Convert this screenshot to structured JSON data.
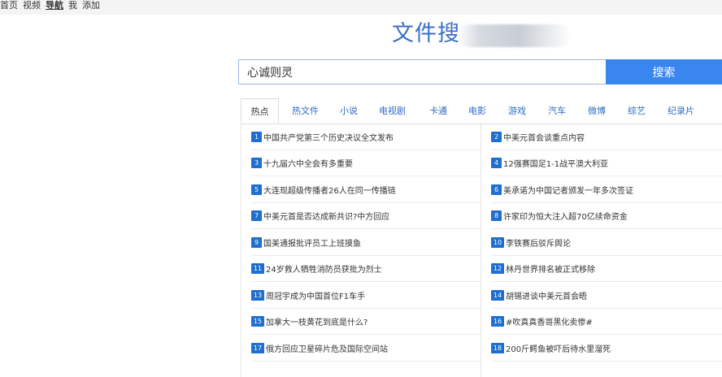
{
  "topnav": {
    "items": [
      "首页",
      "视频",
      "导航",
      "我",
      "添加"
    ],
    "active_index": 2
  },
  "site": {
    "title": "文件搜"
  },
  "search": {
    "value": "心诚则灵",
    "button_label": "搜索"
  },
  "tabs": [
    "热点",
    "热文件",
    "小说",
    "电视剧",
    "卡通",
    "电影",
    "游戏",
    "汽车",
    "微博",
    "综艺",
    "纪录片"
  ],
  "active_tab_index": 0,
  "hot_list": [
    {
      "rank": "1",
      "text": "中国共产党第三个历史决议全文发布"
    },
    {
      "rank": "2",
      "text": "中美元首会谈重点内容"
    },
    {
      "rank": "3",
      "text": "十九届六中全会有多重要"
    },
    {
      "rank": "4",
      "text": "12强赛国足1-1战平澳大利亚"
    },
    {
      "rank": "5",
      "text": "大连现超级传播者26人在同一传播链"
    },
    {
      "rank": "6",
      "text": "美承诺为中国记者颁发一年多次签证"
    },
    {
      "rank": "7",
      "text": "中美元首是否达成新共识?中方回应"
    },
    {
      "rank": "8",
      "text": "许家印为恒大注入超70亿续命资金"
    },
    {
      "rank": "9",
      "text": "国美通报批评员工上班摸鱼"
    },
    {
      "rank": "10",
      "text": "李铁赛后驳斥舆论"
    },
    {
      "rank": "11",
      "text": "24岁救人牺牲消防员获批为烈士"
    },
    {
      "rank": "12",
      "text": "林丹世界排名被正式移除"
    },
    {
      "rank": "13",
      "text": "周冠宇成为中国首位F1车手"
    },
    {
      "rank": "14",
      "text": "胡锡进谈中美元首会晤"
    },
    {
      "rank": "15",
      "text": "加拿大一枝黄花到底是什么?"
    },
    {
      "rank": "16",
      "text": "#吹真真香哥黑化卖惨#"
    },
    {
      "rank": "17",
      "text": "俄方回应卫星碎片危及国际空间站"
    },
    {
      "rank": "18",
      "text": "200斤鳄鱼被吓后待水里溜死"
    }
  ],
  "colors": {
    "accent": "#3a86f0",
    "badge": "#1f6fcf",
    "title": "#3b6fc6",
    "tab_text": "#2f6cc4"
  }
}
